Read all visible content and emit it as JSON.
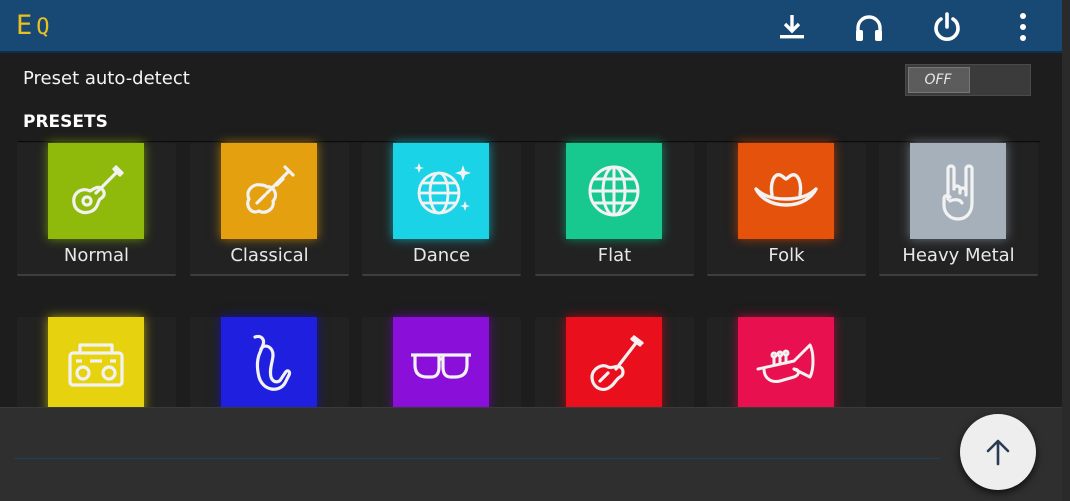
{
  "app": {
    "title_e": "E",
    "title_q": "Q"
  },
  "toolbar": {
    "icons": [
      "download-icon",
      "headphones-icon",
      "power-icon",
      "more-vert-icon"
    ]
  },
  "settings": {
    "autodetect_label": "Preset auto-detect",
    "autodetect_state": "OFF"
  },
  "presets": {
    "header": "PRESETS",
    "items": [
      {
        "label": "Normal",
        "icon": "acoustic-guitar-icon",
        "color": "#8fba0c"
      },
      {
        "label": "Classical",
        "icon": "violin-icon",
        "color": "#e4a00e"
      },
      {
        "label": "Dance",
        "icon": "disco-ball-icon",
        "color": "#1bd3e6"
      },
      {
        "label": "Flat",
        "icon": "globe-icon",
        "color": "#18c98f"
      },
      {
        "label": "Folk",
        "icon": "cowboy-hat-icon",
        "color": "#e4520c"
      },
      {
        "label": "Heavy Metal",
        "icon": "rock-hand-icon",
        "color": "#a5b0bb"
      },
      {
        "label": "",
        "icon": "boombox-icon",
        "color": "#e6d20f"
      },
      {
        "label": "",
        "icon": "saxophone-icon",
        "color": "#1f1fe0"
      },
      {
        "label": "",
        "icon": "sunglasses-icon",
        "color": "#8a0fd8"
      },
      {
        "label": "",
        "icon": "electric-guitar-icon",
        "color": "#ea0f1c"
      },
      {
        "label": "",
        "icon": "trumpet-icon",
        "color": "#e8104e"
      }
    ]
  },
  "fab": {
    "icon": "arrow-up-icon"
  }
}
